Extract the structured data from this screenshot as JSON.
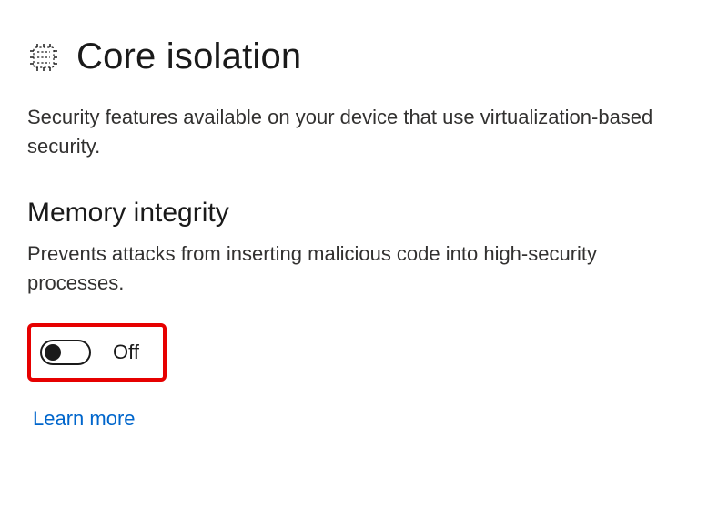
{
  "page": {
    "title": "Core isolation",
    "description": "Security features available on your device that use virtualization-based security.",
    "icon_name": "chip-icon"
  },
  "section": {
    "title": "Memory integrity",
    "description": "Prevents attacks from inserting malicious code into high-security processes.",
    "toggle": {
      "state": "off",
      "label": "Off"
    },
    "learn_more_label": "Learn more"
  },
  "colors": {
    "link": "#0066cc",
    "highlight_border": "#e60000",
    "text": "#323130"
  }
}
